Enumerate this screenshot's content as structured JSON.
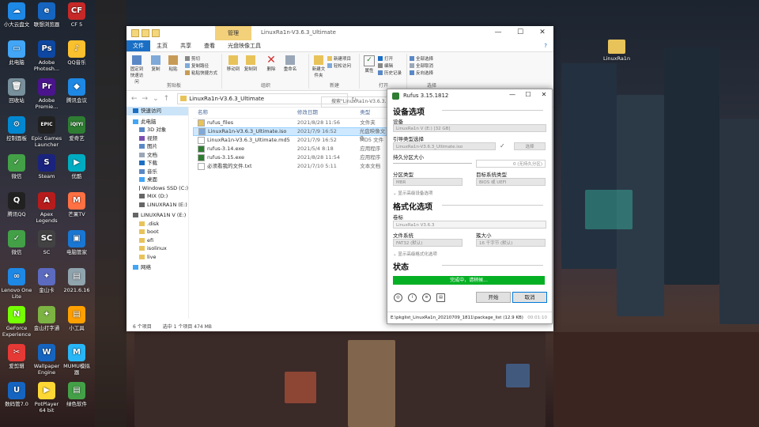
{
  "desktop": {
    "left_icons": [
      {
        "label": "小大云盘文",
        "color": "#1e88e5",
        "glyph": "☁"
      },
      {
        "label": "联想浏览器",
        "color": "#1565c0",
        "glyph": "e"
      },
      {
        "label": "CF 5",
        "color": "#c62828",
        "glyph": "CF"
      },
      {
        "label": "此电脑",
        "color": "#42a5f5",
        "glyph": "▭"
      },
      {
        "label": "Adobe Photosh...",
        "color": "#0d47a1",
        "glyph": "Ps"
      },
      {
        "label": "QQ音乐",
        "color": "#fbc02d",
        "glyph": "♪"
      },
      {
        "label": "回收站",
        "color": "#78909c",
        "glyph": "🗑"
      },
      {
        "label": "Adobe Premie...",
        "color": "#4a148c",
        "glyph": "Pr"
      },
      {
        "label": "腾讯会议",
        "color": "#1e88e5",
        "glyph": "◆"
      },
      {
        "label": "控制面板",
        "color": "#0288d1",
        "glyph": "⚙"
      },
      {
        "label": "Epic Games Launcher",
        "color": "#212121",
        "glyph": "EPIC"
      },
      {
        "label": "爱奇艺",
        "color": "#2e7d32",
        "glyph": "iQIYI"
      },
      {
        "label": "微信",
        "color": "#43a047",
        "glyph": "✓"
      },
      {
        "label": "Steam",
        "color": "#1a237e",
        "glyph": "S"
      },
      {
        "label": "优酷",
        "color": "#00acc1",
        "glyph": "▶"
      },
      {
        "label": "腾讯QQ",
        "color": "#212121",
        "glyph": "Q"
      },
      {
        "label": "Apex Legends",
        "color": "#b71c1c",
        "glyph": "A"
      },
      {
        "label": "芒果TV",
        "color": "#ff7043",
        "glyph": "M"
      },
      {
        "label": "微信",
        "color": "#43a047",
        "glyph": "✓"
      },
      {
        "label": "SC",
        "color": "#424242",
        "glyph": "SC"
      },
      {
        "label": "电脑管家",
        "color": "#1976d2",
        "glyph": "▣"
      },
      {
        "label": "Lenovo One Lite",
        "color": "#1e88e5",
        "glyph": "∞"
      },
      {
        "label": "金山卡",
        "color": "#5c6bc0",
        "glyph": "✦"
      },
      {
        "label": "2021.6.16",
        "color": "#90a4ae",
        "glyph": "▤"
      },
      {
        "label": "GeForce Experience",
        "color": "#76ff03",
        "glyph": "N"
      },
      {
        "label": "金山打字通",
        "color": "#7cb342",
        "glyph": "✦"
      },
      {
        "label": "小工具",
        "color": "#ffa000",
        "glyph": "▤"
      },
      {
        "label": "爱剪辑",
        "color": "#e53935",
        "glyph": "✂"
      },
      {
        "label": "Wallpaper Engine",
        "color": "#1565c0",
        "glyph": "W"
      },
      {
        "label": "MUMU模拟器",
        "color": "#29b6f6",
        "glyph": "M"
      },
      {
        "label": "数码管7.0",
        "color": "#1565c0",
        "glyph": "U"
      },
      {
        "label": "PotPlayer 64 bit",
        "color": "#fdd835",
        "glyph": "▶"
      },
      {
        "label": "绿色软件",
        "color": "#43a047",
        "glyph": "▤"
      }
    ],
    "right_icon": {
      "label": "LinuxRa1n",
      "color": "#e8c35a"
    }
  },
  "explorer": {
    "title": "LinuxRa1n-V3.6.3_Ultimate",
    "manage_tab": "管理",
    "tabs": [
      "文件",
      "主页",
      "共享",
      "查看",
      "光盘映像工具"
    ],
    "ribbon": {
      "pin": "固定到快速访问",
      "copy": "复制",
      "paste": "粘贴",
      "cut": "剪切",
      "copy_path": "复制路径",
      "paste_shortcut": "粘贴快捷方式",
      "move_to": "移动到",
      "copy_to": "复制到",
      "delete": "删除",
      "rename": "重命名",
      "new_folder": "新建文件夹",
      "new_item": "新建项目",
      "easy_access": "轻松访问",
      "properties": "属性",
      "open": "打开",
      "edit": "编辑",
      "history": "历史记录",
      "select_all": "全部选择",
      "select_none": "全部取消",
      "invert": "反向选择",
      "group_clipboard": "剪贴板",
      "group_organize": "组织",
      "group_new": "新建",
      "group_open": "打开",
      "group_select": "选择"
    },
    "address": "LinuxRa1n-V3.6.3_Ultimate",
    "search_placeholder": "搜索\"LinuxRa1n-V3.6.3...",
    "nav_pane": [
      "快速访问",
      "此电脑",
      "3D 对象",
      "视频",
      "图片",
      "文档",
      "下载",
      "音乐",
      "桌面",
      "Windows SSD (C:)",
      "MIX (D:)",
      "LINUXRA1N (E:)",
      "LINUXRA1N V (E:)",
      ".disk",
      "boot",
      "efi",
      "isolinux",
      "live",
      "网络"
    ],
    "columns": [
      "名称",
      "修改日期",
      "类型"
    ],
    "files": [
      {
        "name": "rufus_files",
        "date": "2021/8/28 11:56",
        "type": "文件夹",
        "icon": "folder"
      },
      {
        "name": "LinuxRa1n-V3.6.3_Ultimate.iso",
        "date": "2021/7/9 16:52",
        "type": "光盘映像文件",
        "icon": "disc"
      },
      {
        "name": "LinuxRa1n-V3.6.3_Ultimate.md5",
        "date": "2021/7/9 16:52",
        "type": "MD5 文件",
        "icon": "file"
      },
      {
        "name": "rufus-3.14.exe",
        "date": "2021/5/4 8:18",
        "type": "应用程序",
        "icon": "exe"
      },
      {
        "name": "rufus-3.15.exe",
        "date": "2021/8/28 11:54",
        "type": "应用程序",
        "icon": "exe"
      },
      {
        "name": "必须看我的文件.txt",
        "date": "2021/7/10 5:11",
        "type": "文本文档",
        "icon": "file"
      }
    ],
    "status_count": "6 个项目",
    "status_selected": "选中 1 个项目  474 MB"
  },
  "rufus": {
    "title": "Rufus 3.15.1812",
    "drive_header": "设备选项",
    "device_label": "设备",
    "device_value": "LinuxRa1n V (E:) [32 GB]",
    "boot_label": "引导类型选择",
    "boot_value": "LinuxRa1n-V3.6.3_Ultimate.iso",
    "select_button": "选择",
    "persist_label": "持久分区大小",
    "persist_value": "0 (无持久分区)",
    "partition_label": "分区类型",
    "partition_value": "MBR",
    "target_label": "目标系统类型",
    "target_value": "BIOS 或 UEFI",
    "advanced_drive": "显示高级设备选项",
    "format_header": "格式化选项",
    "volume_label": "卷标",
    "volume_value": "LinuxRa1n V3.6.3",
    "fs_label": "文件系统",
    "fs_value": "FAT32 (默认)",
    "cluster_label": "簇大小",
    "cluster_value": "16 千字节 (默认)",
    "advanced_format": "显示高级格式化选项",
    "status_header": "状态",
    "progress_text": "完成中，请稍候...",
    "start_button": "开始",
    "cancel_button": "取消",
    "status_text": "E:\\pkglist_LinuxRa1n_20210709_1811\\package_list (12.9 KB)",
    "elapsed": "00:01:10"
  }
}
